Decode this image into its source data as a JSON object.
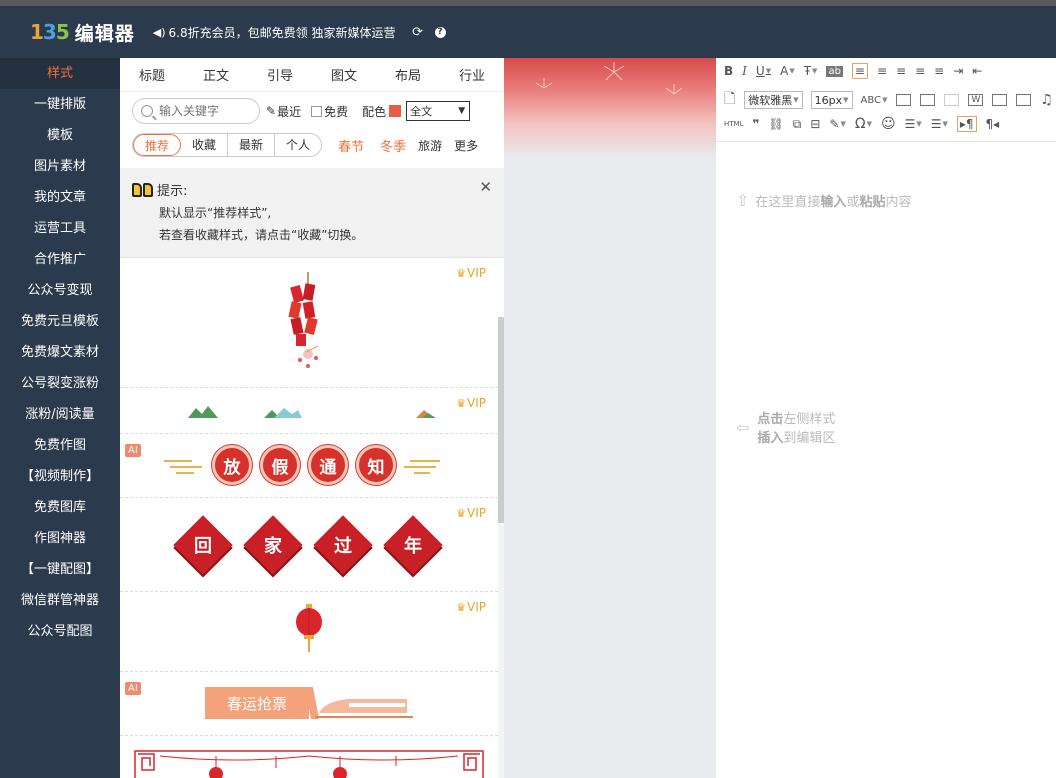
{
  "header": {
    "logo_mark": [
      "1",
      "3",
      "5"
    ],
    "logo_text": "编辑器",
    "notice": "6.8折充会员，包邮免费领 独家新媒体运营",
    "refresh_icon": "refresh-icon",
    "help_icon": "help-icon"
  },
  "sidebar": {
    "items": [
      {
        "label": "样式",
        "active": true
      },
      {
        "label": "一键排版"
      },
      {
        "label": "模板"
      },
      {
        "label": "图片素材"
      },
      {
        "label": "我的文章"
      },
      {
        "label": "运营工具"
      },
      {
        "label": "合作推广"
      },
      {
        "label": "公众号变现"
      },
      {
        "label": "免费元旦模板"
      },
      {
        "label": "免费爆文素材"
      },
      {
        "label": "公号裂变涨粉"
      },
      {
        "label": "涨粉/阅读量"
      },
      {
        "label": "免费作图"
      },
      {
        "label": "【视频制作】"
      },
      {
        "label": "免费图库"
      },
      {
        "label": "作图神器"
      },
      {
        "label": "【一键配图】"
      },
      {
        "label": "微信群管神器"
      },
      {
        "label": "公众号配图"
      }
    ]
  },
  "panel": {
    "categories": [
      "标题",
      "正文",
      "引导",
      "图文",
      "布局",
      "行业"
    ],
    "search": {
      "placeholder": "输入关键字"
    },
    "recent_label": "最近",
    "free_label": "免费",
    "color_label": "配色",
    "scope_select": "全文",
    "filters": [
      "推荐",
      "收藏",
      "最新",
      "个人"
    ],
    "seasons": [
      "春节",
      "冬季"
    ],
    "travel": "旅游",
    "more": "更多",
    "tip": {
      "title": "提示:",
      "line1": "默认显示“推荐样式”,",
      "line2": "若查看收藏样式，请点击“收藏”切换。"
    },
    "vip_label": "VIP",
    "ai_label": "AI",
    "holiday_chars": [
      "放",
      "假",
      "通",
      "知"
    ],
    "home_chars": [
      "回",
      "家",
      "过",
      "年"
    ],
    "ticket_label": "春运抢票"
  },
  "editor": {
    "font_select": "微软雅黑",
    "size_select": "16px",
    "hint_top": {
      "pre": "在这里直接",
      "b1": "输入",
      "mid": "或",
      "b2": "粘贴",
      "post": "内容"
    },
    "hint_left": {
      "b1": "点击",
      "l1": "左侧样式",
      "b2": "插入",
      "l2": "到编辑区"
    }
  }
}
